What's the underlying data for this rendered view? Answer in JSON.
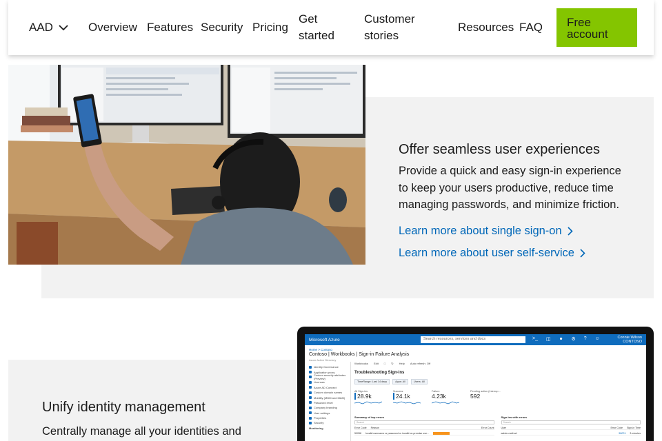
{
  "nav": {
    "brand": "AAD",
    "items": [
      "Overview",
      "Features",
      "Security",
      "Pricing",
      "Get started",
      "Customer stories",
      "Resources",
      "FAQ"
    ],
    "get_started_l1": "Get",
    "get_started_l2": "started",
    "customer_l1": "Customer",
    "customer_l2": "stories",
    "cta_l1": "Free",
    "cta_l2": "account"
  },
  "section1": {
    "heading": "Offer seamless user experiences",
    "body": "Provide a quick and easy sign-in experience to keep your users productive, reduce time managing passwords, and minimize friction.",
    "link1": "Learn more about single sign-on",
    "link2": "Learn more about user self-service"
  },
  "section2": {
    "heading": "Unify identity management",
    "body": "Centrally manage all your identities and"
  },
  "portal": {
    "brand": "Microsoft Azure",
    "search_placeholder": "Search resources, services and docs",
    "user_name": "Connie Wilson",
    "user_org": "CONTOSO",
    "breadcrumb": "Home > Contoso",
    "title": "Contoso | Workbooks | Sign-in Failure Analysis",
    "subtitle": "Azure Active Directory",
    "side_items": [
      "Identity Governance",
      "Application proxy",
      "Custom security attributes (Preview)",
      "Licenses",
      "Azure AD Connect",
      "Custom domain names",
      "Mobility (MDM and MAM)",
      "Password reset",
      "Company branding",
      "User settings",
      "Properties",
      "Security",
      "Monitoring"
    ],
    "toolbar": [
      "Workbooks",
      "Edit",
      "Auto refresh: Off",
      "Help"
    ],
    "section_title": "Troubleshooting Sign-ins",
    "pills": [
      "TimeRange: Last 14 days",
      "Apps: All",
      "Users: All"
    ],
    "metrics": [
      {
        "label": "All Sign-ins",
        "value": "28.9k"
      },
      {
        "label": "Success",
        "value": "24.1k"
      },
      {
        "label": "Failure",
        "value": "4.23k"
      },
      {
        "label": "Pending action (Interrup...",
        "value": "592"
      }
    ],
    "table1_title": "Summary of top errors",
    "table2_title": "Sign-ins with errors",
    "table_search": "Search",
    "table1_cols": [
      "Error Code",
      "Reason",
      "Error Count"
    ],
    "table2_cols": [
      "User",
      "Error Code",
      "Sign-in Time"
    ],
    "table1_row": [
      "50058",
      "Invalid username or password or invalid on-premise use..."
    ],
    "table2_row": [
      "admin-method",
      "50074",
      "3 minutes"
    ]
  }
}
